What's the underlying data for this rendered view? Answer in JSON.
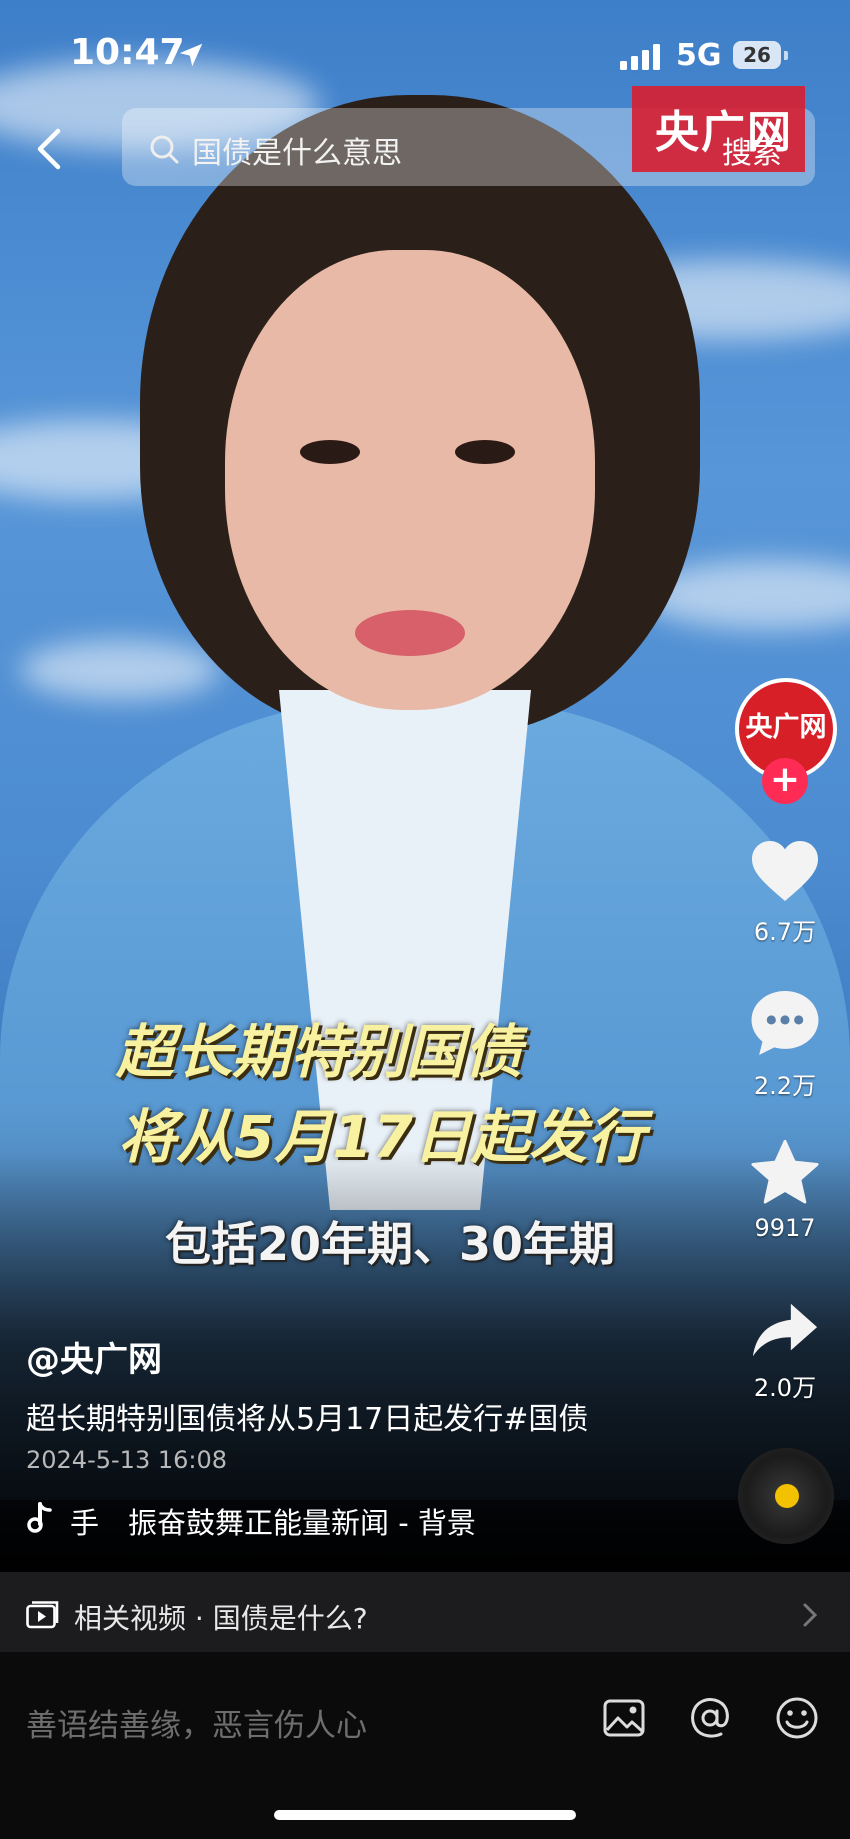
{
  "status_bar": {
    "time": "10:47",
    "network": "5G",
    "battery": "26"
  },
  "header": {
    "search_query": "国债是什么意思",
    "watermark_text": "央广网",
    "search_button": "搜索"
  },
  "video": {
    "caption_line1": "超长期特别国债",
    "caption_line2": "将从5月17日起发行",
    "caption_line3": "包括20年期、30年期"
  },
  "sidebar": {
    "avatar_text": "央广网",
    "follow_label": "+",
    "likes": "6.7万",
    "comments": "2.2万",
    "favorites": "9917",
    "shares": "2.0万"
  },
  "post": {
    "author": "@央广网",
    "description": "超长期特别国债将从5月17日起发行#国债",
    "date": "2024-5-13 16:08",
    "music": "手　振奋鼓舞正能量新闻 - 背景"
  },
  "related": {
    "label": "相关视频 · 国债是什么?"
  },
  "comment_bar": {
    "placeholder": "善语结善缘，恶言伤人心"
  },
  "colors": {
    "brand_red": "#d71f28",
    "follow_pink": "#fe2c55",
    "caption_yellow": "#f7f1a0"
  }
}
